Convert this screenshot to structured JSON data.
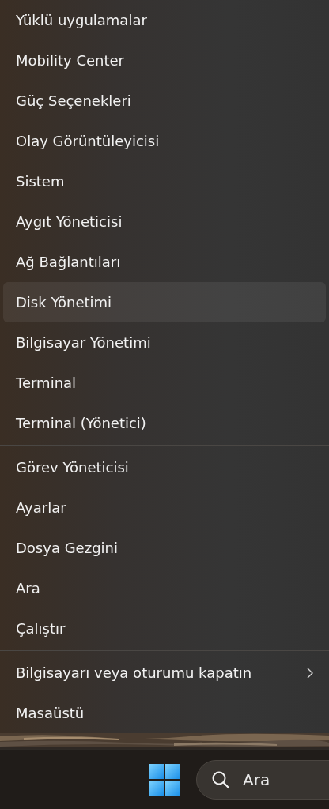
{
  "menu": {
    "groups": [
      {
        "items": [
          {
            "label": "Yüklü uygulamalar",
            "selected": false
          },
          {
            "label": "Mobility Center",
            "selected": false
          },
          {
            "label": "Güç Seçenekleri",
            "selected": false
          },
          {
            "label": "Olay Görüntüleyicisi",
            "selected": false
          },
          {
            "label": "Sistem",
            "selected": false
          },
          {
            "label": "Aygıt Yöneticisi",
            "selected": false
          },
          {
            "label": "Ağ Bağlantıları",
            "selected": false
          },
          {
            "label": "Disk Yönetimi",
            "selected": true
          },
          {
            "label": "Bilgisayar Yönetimi",
            "selected": false
          },
          {
            "label": "Terminal",
            "selected": false
          },
          {
            "label": "Terminal (Yönetici)",
            "selected": false
          }
        ]
      },
      {
        "items": [
          {
            "label": "Görev Yöneticisi",
            "selected": false
          },
          {
            "label": "Ayarlar",
            "selected": false
          },
          {
            "label": "Dosya Gezgini",
            "selected": false
          },
          {
            "label": "Ara",
            "selected": false
          },
          {
            "label": "Çalıştır",
            "selected": false
          }
        ]
      },
      {
        "items": [
          {
            "label": "Bilgisayarı veya oturumu kapatın",
            "selected": false,
            "submenu": true
          },
          {
            "label": "Masaüstü",
            "selected": false
          }
        ]
      }
    ]
  },
  "taskbar": {
    "search": {
      "placeholder": "Ara"
    }
  }
}
